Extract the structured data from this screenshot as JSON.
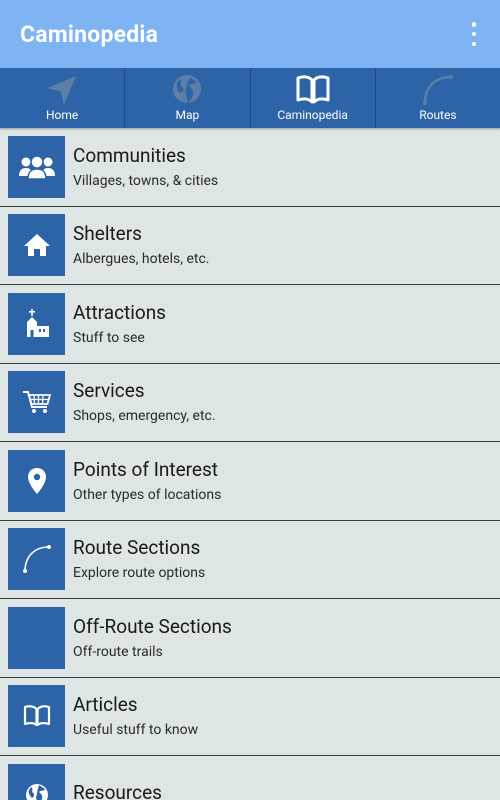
{
  "appbar": {
    "title": "Caminopedia",
    "menu_icon": "overflow-vertical-icon"
  },
  "tabs": [
    {
      "label": "Home",
      "icon": "navigation-arrow-icon"
    },
    {
      "label": "Map",
      "icon": "globe-icon"
    },
    {
      "label": "Caminopedia",
      "icon": "open-book-icon"
    },
    {
      "label": "Routes",
      "icon": "route-curve-icon"
    }
  ],
  "items": [
    {
      "title": "Communities",
      "subtitle": "Villages, towns, & cities",
      "icon": "people-group-icon"
    },
    {
      "title": "Shelters",
      "subtitle": "Albergues, hotels, etc.",
      "icon": "house-icon"
    },
    {
      "title": "Attractions",
      "subtitle": "Stuff to see",
      "icon": "church-icon"
    },
    {
      "title": "Services",
      "subtitle": "Shops, emergency, etc.",
      "icon": "shopping-cart-icon"
    },
    {
      "title": "Points of Interest",
      "subtitle": "Other types of locations",
      "icon": "map-pin-icon"
    },
    {
      "title": "Route Sections",
      "subtitle": "Explore route options",
      "icon": "route-curve-icon"
    },
    {
      "title": "Off-Route Sections",
      "subtitle": "Off-route trails",
      "icon": "blank-icon"
    },
    {
      "title": "Articles",
      "subtitle": "Useful stuff to know",
      "icon": "open-book-icon"
    },
    {
      "title": "Resources",
      "subtitle": "",
      "icon": "globe-icon"
    }
  ],
  "colors": {
    "appbar": "#7fb4f3",
    "tabbar": "#2d64a8",
    "tile": "#2d64a8",
    "background": "#dde6e4"
  }
}
